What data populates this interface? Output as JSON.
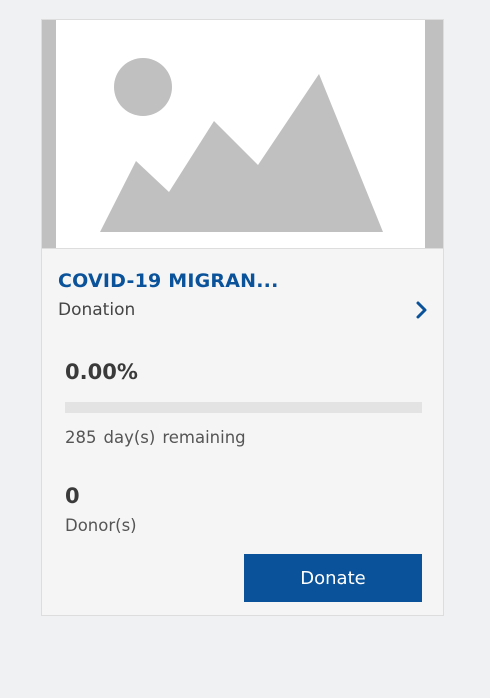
{
  "campaign": {
    "image_icon": "image-placeholder-icon",
    "title": "COVID-19 MIGRAN...",
    "category": "Donation",
    "chevron_icon": "chevron-right-icon",
    "progress_text": "0.00%",
    "progress_fraction": 0.0,
    "days_count": "285",
    "days_unit": "day(s)",
    "days_suffix": "remaining",
    "donor_count": "0",
    "donor_label": "Donor(s)",
    "donate_label": "Donate"
  },
  "colors": {
    "brand": "#0a5299",
    "background": "#f0f1f3",
    "card": "#f5f5f6",
    "placeholder_gray": "#c0c0c0",
    "track": "#e3e3e3"
  }
}
